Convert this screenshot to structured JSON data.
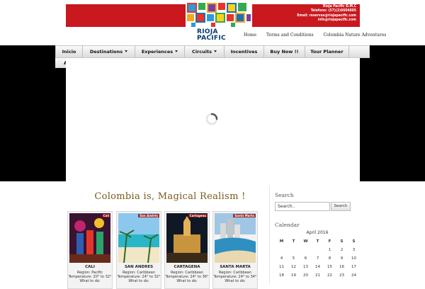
{
  "header": {
    "brand_line1": "RIOJA",
    "brand_line2": "PACIFIC",
    "contact": [
      "Rioja Pacific D.M.C",
      "Telefono: (57)(2)6604805",
      "Email: reservas@riojapacific.com",
      "info@riojapacific.com"
    ],
    "links": [
      "Home",
      "Terms and Conditions",
      "Colombia Nature Adventures"
    ],
    "banner_color": "#c9181e"
  },
  "nav": {
    "items": [
      {
        "label": "Inicio",
        "dropdown": false
      },
      {
        "label": "Destinations",
        "dropdown": true
      },
      {
        "label": "Experiences",
        "dropdown": true
      },
      {
        "label": "Circuits",
        "dropdown": true
      },
      {
        "label": "Incentives",
        "dropdown": false
      },
      {
        "label": "Buy Now !!",
        "dropdown": false
      },
      {
        "label": "Tour Planner",
        "dropdown": false
      }
    ],
    "row2_label": "A"
  },
  "content": {
    "headline": "Colombia is, Magical Realism !",
    "cards": [
      {
        "title": "CALI",
        "tag": "Cali",
        "region": "Region: Pacific",
        "temperature": "Temperature: 20° to 32°",
        "todo": "What to do:"
      },
      {
        "title": "SAN ANDRES",
        "tag": "San Andrés",
        "region": "Region: Caribbean",
        "temperature": "Temperature: 24° to 32°",
        "todo": "What to do:"
      },
      {
        "title": "CARTAGENA",
        "tag": "Cartagena",
        "region": "Region: Caribbean",
        "temperature": "Temperature: 24° to 36°",
        "todo": "What to do:"
      },
      {
        "title": "SANTA MARTA",
        "tag": "Santa Marta",
        "region": "Region: Caribbean",
        "temperature": "Temperature: 24° to 34°",
        "todo": "What to do:"
      }
    ]
  },
  "sidebar": {
    "search_title": "Search",
    "search_value": "Search..",
    "search_button": "Search",
    "calendar_title": "Calendar",
    "calendar_caption": "April 2016",
    "weekdays": [
      "M",
      "T",
      "W",
      "T",
      "F",
      "S",
      "S"
    ],
    "weeks": [
      [
        "",
        "",
        "",
        "",
        "1",
        "2",
        "3"
      ],
      [
        "4",
        "5",
        "6",
        "7",
        "8",
        "9",
        "10"
      ],
      [
        "11",
        "12",
        "13",
        "14",
        "15",
        "16",
        "17"
      ],
      [
        "18",
        "19",
        "20",
        "21",
        "22",
        "23",
        "24"
      ]
    ]
  }
}
